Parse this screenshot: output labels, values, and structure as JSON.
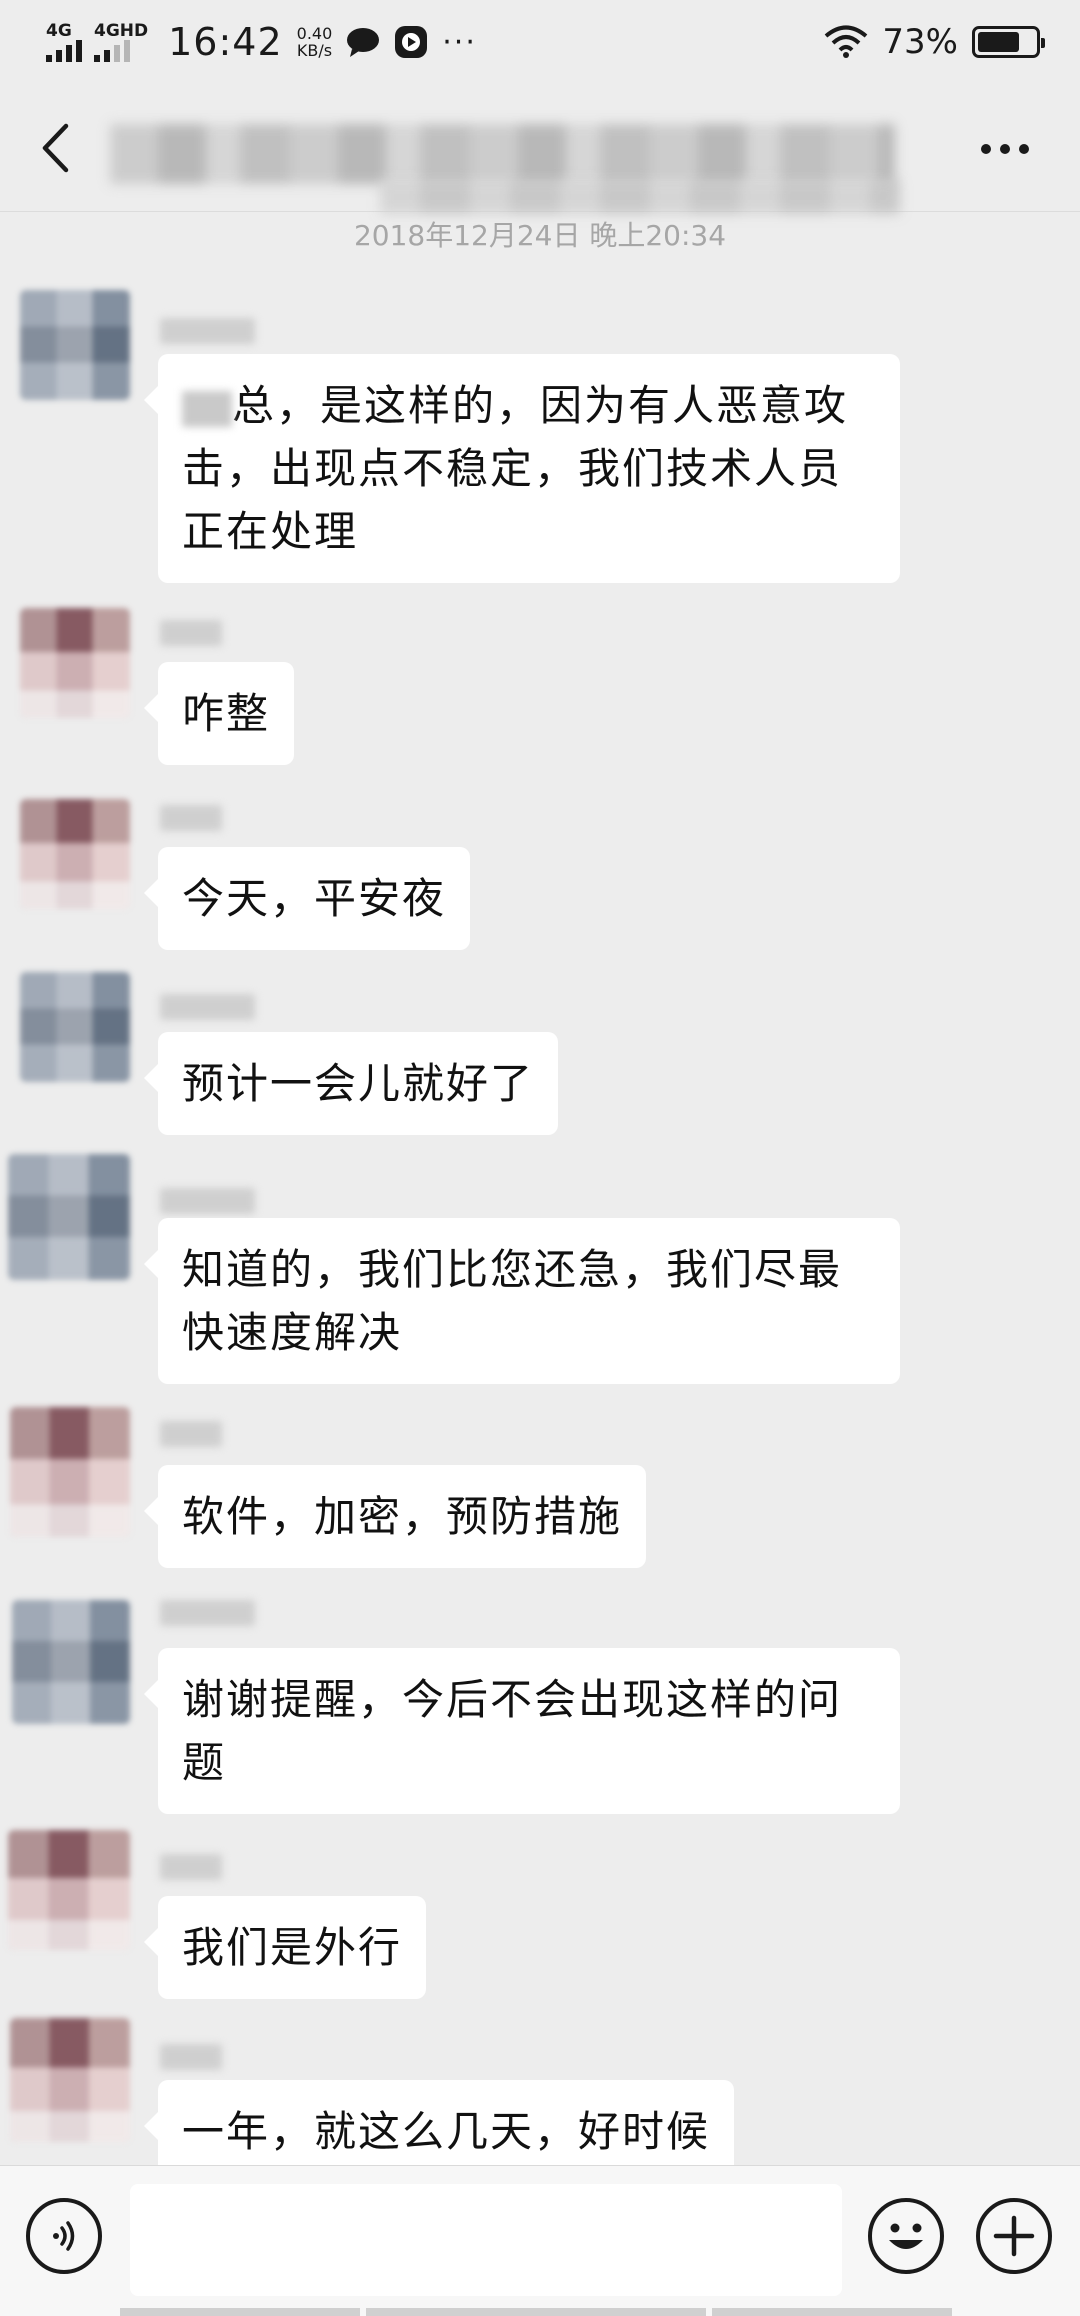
{
  "status_bar": {
    "network1": "4G",
    "network2": "4GHD",
    "time": "16:42",
    "speed_value": "0.40",
    "speed_unit": "KB/s",
    "more": "···",
    "battery": "73%",
    "battery_level": 0.73
  },
  "nav": {
    "more_label": "···"
  },
  "chat": {
    "timestamp": "2018年12月24日 晚上20:34",
    "messages": [
      {
        "avatar": "blue",
        "text": "总，是这样的，因为有人恶意攻击，出现点不稳定，我们技术人员正在处理"
      },
      {
        "avatar": "pink",
        "text": "咋整"
      },
      {
        "avatar": "pink",
        "text": "今天，平安夜"
      },
      {
        "avatar": "blue",
        "text": "预计一会儿就好了"
      },
      {
        "avatar": "blue",
        "text": "知道的，我们比您还急，我们尽最快速度解决"
      },
      {
        "avatar": "pink",
        "text": "软件，加密，预防措施"
      },
      {
        "avatar": "blue",
        "text": "谢谢提醒，今后不会出现这样的问题"
      },
      {
        "avatar": "pink",
        "text": "我们是外行"
      },
      {
        "avatar": "pink",
        "text": "一年，就这么几天，好时候"
      }
    ]
  },
  "input_bar": {
    "text_value": "",
    "icons": [
      "voice-icon",
      "emoji-icon",
      "plus-icon"
    ]
  }
}
